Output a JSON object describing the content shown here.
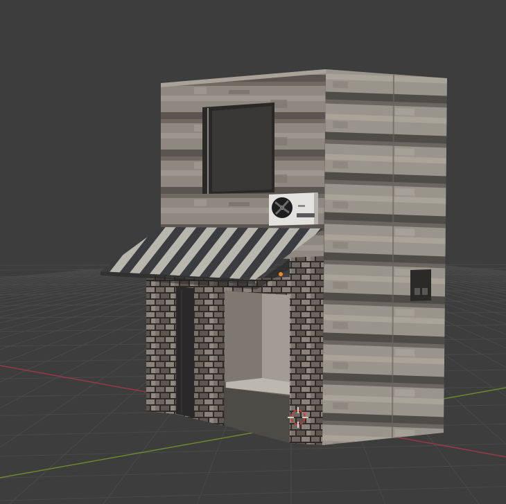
{
  "viewport": {
    "kind": "3d-viewport",
    "background": "#3d3d3d",
    "grid_color": "#4a4a4a",
    "x_axis_color": "#9a3a46",
    "y_axis_color": "#6a8a2e"
  },
  "scene": {
    "model": "building",
    "wall_material": "concrete",
    "ground_floor_material": "brick",
    "awning_stripe_colors": [
      "#3a3c40",
      "#b9b6ae"
    ],
    "origin_color": "#f08a24",
    "cursor_colors": [
      "#d8362a",
      "#ffffff"
    ],
    "objects": [
      {
        "name": "upper-window",
        "icon": "window-icon"
      },
      {
        "name": "air-conditioner-unit",
        "icon": "fan-icon"
      },
      {
        "name": "striped-awning",
        "icon": "awning-icon"
      },
      {
        "name": "shop-door",
        "icon": "door-icon"
      },
      {
        "name": "shop-window",
        "icon": "window-icon"
      },
      {
        "name": "electric-box",
        "icon": "box-icon"
      },
      {
        "name": "object-origin",
        "icon": "dot-icon"
      },
      {
        "name": "3d-cursor",
        "icon": "crosshair-icon"
      }
    ]
  }
}
